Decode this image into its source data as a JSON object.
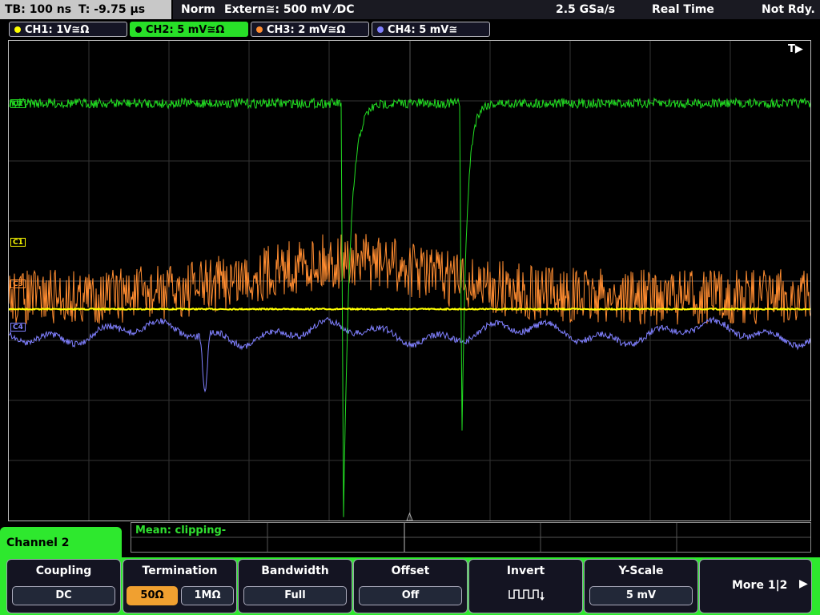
{
  "status": {
    "timebase": "TB: 100 ns",
    "trigger_time": "T: -9.75 µs",
    "trigger_mode": "Norm",
    "trigger_source": "Extern≅: 500 mV ⁄DC",
    "sample_rate": "2.5 GSa/s",
    "acq_mode": "Real Time",
    "ready_state": "Not Rdy."
  },
  "channels": [
    {
      "label": "CH1: 1V≅Ω",
      "color": "#ffff00"
    },
    {
      "label": "CH2: 5 mV≅Ω",
      "color": "#22dd22"
    },
    {
      "label": "CH3: 2 mV≅Ω",
      "color": "#ff8c30"
    },
    {
      "label": "CH4: 5 mV≅",
      "color": "#8080ff"
    }
  ],
  "trace_labels": {
    "c1": "C1",
    "c2": "C2",
    "c3": "C3",
    "c4": "C4",
    "trigger_marker": "T"
  },
  "measurement": {
    "text": "Mean: clipping-"
  },
  "panel": {
    "title": "Channel 2",
    "coupling": {
      "title": "Coupling",
      "value": "DC"
    },
    "termination": {
      "title": "Termination",
      "opt1": "50Ω",
      "opt2": "1MΩ"
    },
    "bandwidth": {
      "title": "Bandwidth",
      "value": "Full"
    },
    "offset": {
      "title": "Offset",
      "value": "Off"
    },
    "invert": {
      "title": "Invert"
    },
    "yscale": {
      "title": "Y-Scale",
      "value": "5 mV"
    },
    "more": {
      "label": "More 1|2"
    }
  }
}
